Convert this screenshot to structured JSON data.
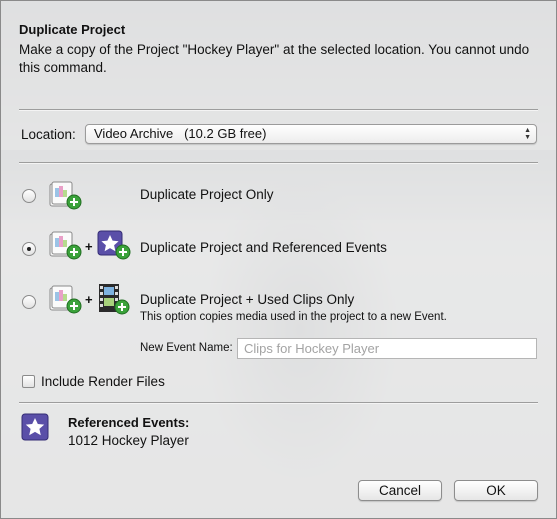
{
  "background": {
    "title_ghost": "Hockey Player"
  },
  "dialog": {
    "title": "Duplicate Project",
    "description": "Make a copy of the Project \"Hockey Player\" at the selected location. You cannot undo this command."
  },
  "location": {
    "label": "Location:",
    "value": "Video Archive   (10.2 GB free)"
  },
  "options": [
    {
      "label": "Duplicate Project Only",
      "selected": false,
      "icons": [
        "project-icon"
      ]
    },
    {
      "label": "Duplicate Project and Referenced Events",
      "selected": true,
      "icons": [
        "project-icon",
        "event-icon"
      ]
    },
    {
      "label": "Duplicate Project + Used Clips Only",
      "selected": false,
      "icons": [
        "project-icon",
        "film-clip-icon"
      ],
      "note": "This option copies media used in the project to a new Event."
    }
  ],
  "plus_sign": "+",
  "new_event": {
    "label": "New Event Name:",
    "placeholder": "Clips for Hockey Player"
  },
  "render_files": {
    "label": "Include Render Files",
    "checked": false
  },
  "referenced": {
    "title": "Referenced Events:",
    "value": "1012 Hockey Player"
  },
  "buttons": {
    "cancel": "Cancel",
    "ok": "OK"
  },
  "colors": {
    "event_purple": "#5a4fa8",
    "add_green": "#3aa23a"
  }
}
